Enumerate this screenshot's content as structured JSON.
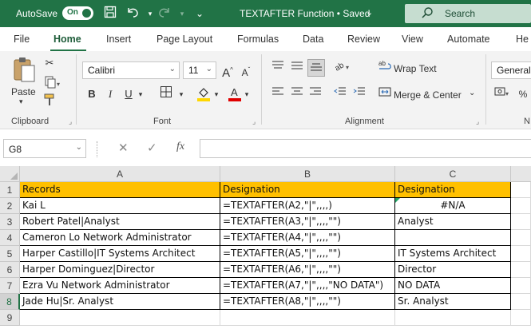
{
  "titlebar": {
    "autosave_label": "AutoSave",
    "autosave_state": "On",
    "document_title": "TEXTAFTER Function • Saved",
    "search_placeholder": "Search"
  },
  "tabs": [
    "File",
    "Home",
    "Insert",
    "Page Layout",
    "Formulas",
    "Data",
    "Review",
    "View",
    "Automate",
    "He"
  ],
  "active_tab": "Home",
  "ribbon": {
    "clipboard": {
      "paste_label": "Paste",
      "group_label": "Clipboard"
    },
    "font": {
      "font_name": "Calibri",
      "font_size": "11",
      "bold": "B",
      "italic": "I",
      "underline": "U",
      "grow": "A",
      "shrink": "A",
      "group_label": "Font"
    },
    "alignment": {
      "wrap_text": "Wrap Text",
      "merge_center": "Merge & Center",
      "group_label": "Alignment"
    },
    "number": {
      "format": "General",
      "group_label": "N"
    }
  },
  "formula_bar": {
    "name_box": "G8",
    "fx": "fx",
    "formula": ""
  },
  "grid": {
    "columns": [
      "A",
      "B",
      "C"
    ],
    "rows": [
      {
        "num": "1",
        "a": "Records",
        "b": "Designation",
        "c": "Designation"
      },
      {
        "num": "2",
        "a": "Kai L",
        "b": "=TEXTAFTER(A2,\"|\",,,,)",
        "c": "#N/A"
      },
      {
        "num": "3",
        "a": "Robert Patel|Analyst",
        "b": "=TEXTAFTER(A3,\"|\",,,,\"\")",
        "c": "Analyst"
      },
      {
        "num": "4",
        "a": "Cameron Lo Network Administrator",
        "b": "=TEXTAFTER(A4,\"|\",,,,\"\")",
        "c": ""
      },
      {
        "num": "5",
        "a": "Harper Castillo|IT Systems Architect",
        "b": "=TEXTAFTER(A5,\"|\",,,,\"\")",
        "c": "IT Systems Architect"
      },
      {
        "num": "6",
        "a": "Harper Dominguez|Director",
        "b": "=TEXTAFTER(A6,\"|\",,,,\"\")",
        "c": "Director"
      },
      {
        "num": "7",
        "a": "Ezra Vu Network Administrator",
        "b": "=TEXTAFTER(A7,\"|\",,,,\"NO DATA\")",
        "c": "NO DATA"
      },
      {
        "num": "8",
        "a": "Jade Hu|Sr. Analyst",
        "b": "=TEXTAFTER(A8,\"|\",,,,\"\")",
        "c": "Sr. Analyst"
      },
      {
        "num": "9",
        "a": "",
        "b": "",
        "c": ""
      }
    ]
  },
  "colors": {
    "brand": "#217346",
    "header_fill": "#ffc000",
    "font_color_bar": "#e00000",
    "fill_color_bar": "#ffd700"
  }
}
